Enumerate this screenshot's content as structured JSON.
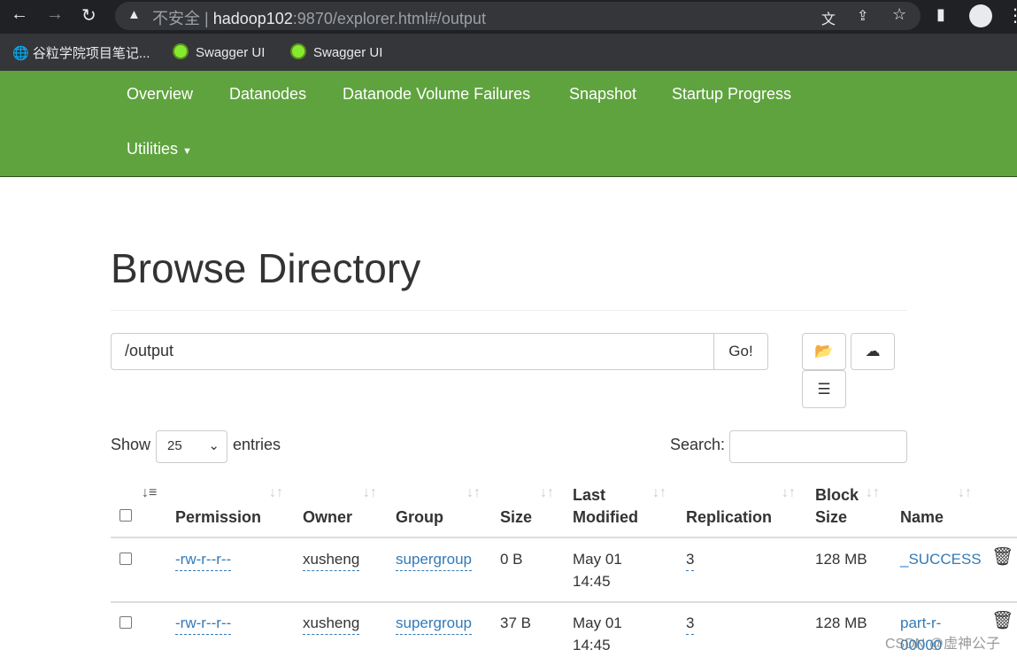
{
  "browser": {
    "insecure_label": "不安全",
    "url_host": "hadoop102",
    "url_rest": ":9870/explorer.html#/output",
    "bookmarks": [
      "谷粒学院项目笔记...",
      "Swagger UI",
      "Swagger UI"
    ]
  },
  "nav": {
    "items": [
      "Overview",
      "Datanodes",
      "Datanode Volume Failures",
      "Snapshot",
      "Startup Progress",
      "Utilities"
    ]
  },
  "page": {
    "title": "Browse Directory",
    "path_value": "/output",
    "go_label": "Go!",
    "show_label": "Show",
    "entries_value": "25",
    "entries_label": "entries",
    "search_label": "Search:",
    "search_value": ""
  },
  "table": {
    "headers": [
      "Permission",
      "Owner",
      "Group",
      "Size",
      "Last",
      "Modified",
      "Replication",
      "Block",
      "Size",
      "Name"
    ],
    "rows": [
      {
        "permission": "-rw-r--r--",
        "owner": "xusheng",
        "group": "supergroup",
        "size": "0 B",
        "date": "May 01",
        "time": "14:45",
        "replication": "3",
        "block": "128 MB",
        "name": "_SUCCESS",
        "name2": ""
      },
      {
        "permission": "-rw-r--r--",
        "owner": "xusheng",
        "group": "supergroup",
        "size": "37 B",
        "date": "May 01",
        "time": "14:45",
        "replication": "3",
        "block": "128 MB",
        "name": "part-r-",
        "name2": "00000"
      }
    ]
  },
  "watermark": "CSDN @虚神公子",
  "colors": {
    "nav_green": "#5fa33e",
    "link": "#337ab7"
  }
}
